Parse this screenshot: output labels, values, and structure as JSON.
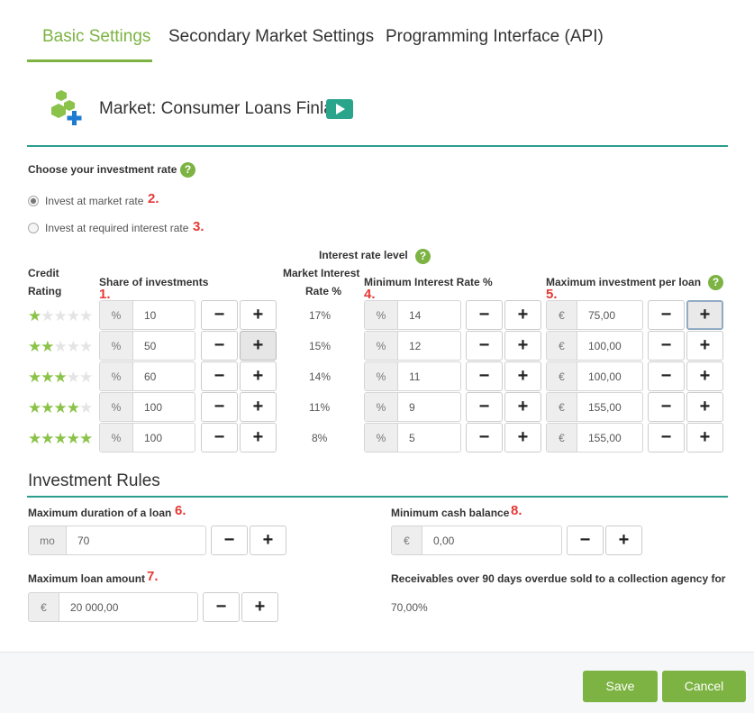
{
  "tabs": [
    "Basic Settings",
    "Secondary Market Settings",
    "Programming Interface (API)"
  ],
  "market": {
    "title": "Market: Consumer Loans Finland"
  },
  "investment_rate": {
    "heading": "Choose your investment rate",
    "options": [
      "Invest at market rate",
      "Invest at required interest rate"
    ],
    "selected": 0
  },
  "markers": {
    "n1": "1.",
    "n2": "2.",
    "n3": "3.",
    "n4": "4.",
    "n5": "5.",
    "n6": "6.",
    "n7": "7.",
    "n8": "8."
  },
  "grid": {
    "credit_rating_header": [
      "Credit",
      "Rating"
    ],
    "share_header": "Share of investments",
    "interest_level_header": "Interest rate level",
    "market_rate_header": [
      "Market Interest",
      "Rate %"
    ],
    "min_rate_header": "Minimum Interest Rate %",
    "max_invest_header": "Maximum investment per loan",
    "percent_addon": "%",
    "euro_addon": "€",
    "rows": [
      {
        "stars": 1,
        "share": "10",
        "market_rate": "17%",
        "min_rate": "14",
        "max_invest": "75,00"
      },
      {
        "stars": 2,
        "share": "50",
        "market_rate": "15%",
        "min_rate": "12",
        "max_invest": "100,00"
      },
      {
        "stars": 3,
        "share": "60",
        "market_rate": "14%",
        "min_rate": "11",
        "max_invest": "100,00"
      },
      {
        "stars": 4,
        "share": "100",
        "market_rate": "11%",
        "min_rate": "9",
        "max_invest": "155,00"
      },
      {
        "stars": 5,
        "share": "100",
        "market_rate": "8%",
        "min_rate": "5",
        "max_invest": "155,00"
      }
    ]
  },
  "rules": {
    "title": "Investment Rules",
    "max_duration": {
      "label": "Maximum duration of a loan",
      "addon": "mo",
      "value": "70"
    },
    "min_cash": {
      "label": "Minimum cash balance",
      "addon": "€",
      "value": "0,00"
    },
    "max_amount": {
      "label": "Maximum loan amount",
      "addon": "€",
      "value": "20 000,00"
    },
    "receivables": {
      "label": "Receivables over 90 days overdue sold to a collection agency for",
      "value": "70,00%"
    }
  },
  "buttons": {
    "minus": "−",
    "plus": "+",
    "help": "?",
    "save": "Save",
    "cancel": "Cancel"
  },
  "colors": {
    "accent": "#7cb342",
    "teal": "#2a9d8f",
    "marker": "#e53935"
  }
}
